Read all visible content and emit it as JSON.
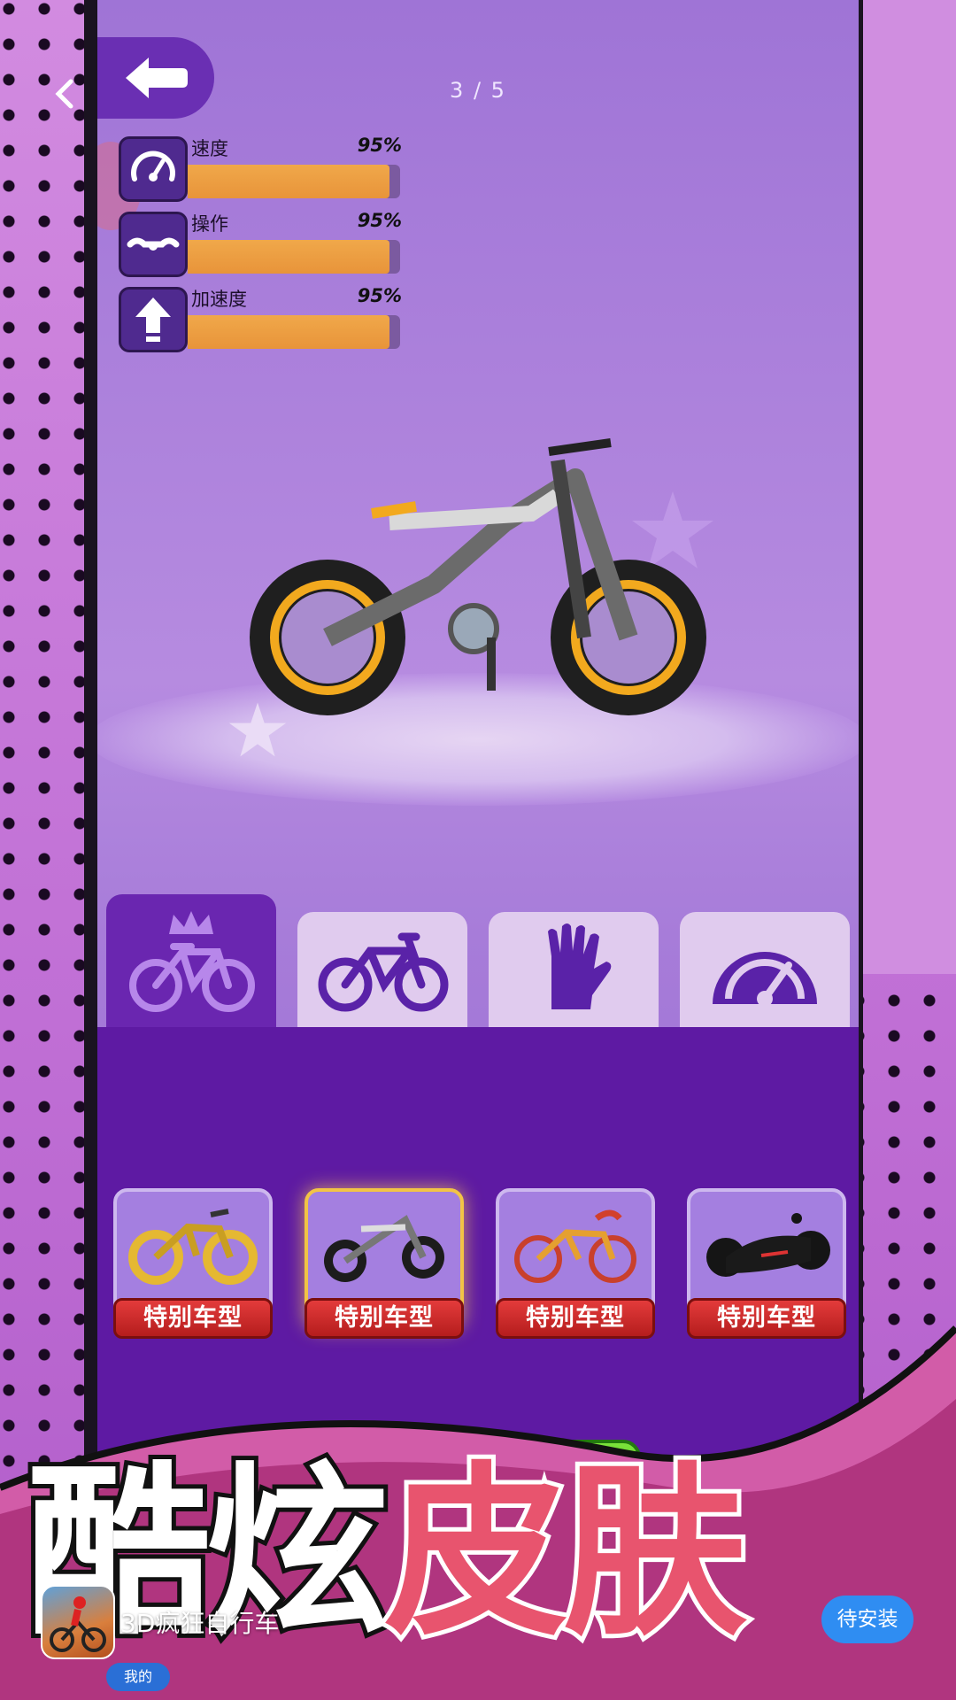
{
  "header": {
    "page_counter": "3 / 5"
  },
  "stats": [
    {
      "label": "速度",
      "value": "95%",
      "level": 0.95,
      "icon": "speedometer-icon"
    },
    {
      "label": "操作",
      "value": "95%",
      "level": 0.95,
      "icon": "handlebar-icon"
    },
    {
      "label": "加速度",
      "value": "95%",
      "level": 0.95,
      "icon": "up-arrow-icon"
    }
  ],
  "tabs": [
    {
      "icon": "crowned-bike-icon",
      "active": true
    },
    {
      "icon": "bike-icon",
      "active": false
    },
    {
      "icon": "glove-icon",
      "active": false
    },
    {
      "icon": "gauge-icon",
      "active": false
    }
  ],
  "cards": [
    {
      "label": "特别车型",
      "thumb": "golden-bike",
      "selected": false
    },
    {
      "label": "特别车型",
      "thumb": "moto-bike",
      "selected": true
    },
    {
      "label": "特别车型",
      "thumb": "dragon-bike",
      "selected": false
    },
    {
      "label": "特别车型",
      "thumb": "black-futuristic-bike",
      "selected": false
    }
  ],
  "promo": {
    "white_text": "酷炫",
    "pink_text": "皮肤"
  },
  "app_bar": {
    "app_name": "3D疯狂自行车",
    "install_label": "待安装",
    "mine_label": "我的"
  },
  "colors": {
    "panel_purple": "#5e1aa3",
    "tab_active": "#6a26b0",
    "stat_fill": "#e8943a",
    "card_label_red": "#c42626",
    "promo_pink": "#e8546e",
    "install_blue": "#2f8df2"
  }
}
